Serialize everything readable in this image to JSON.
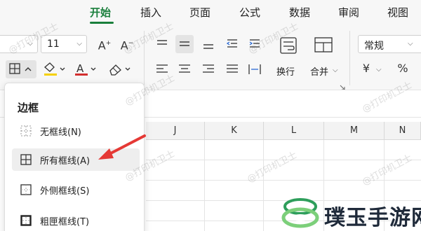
{
  "tabs": [
    {
      "label": "开始",
      "active": true
    },
    {
      "label": "插入",
      "active": false
    },
    {
      "label": "页面",
      "active": false
    },
    {
      "label": "公式",
      "active": false
    },
    {
      "label": "数据",
      "active": false
    },
    {
      "label": "审阅",
      "active": false
    },
    {
      "label": "视图",
      "active": false
    }
  ],
  "ribbon": {
    "font_size": "11",
    "number_format": "常规",
    "wrap_label": "换行",
    "merge_label": "合并",
    "currency_symbol": "¥",
    "percent_symbol": "%",
    "font_color": "#d32f2f",
    "fill_color": "#f5d000"
  },
  "columns": [
    "J",
    "K",
    "L",
    "M",
    "N"
  ],
  "border_menu": {
    "title": "边框",
    "items": [
      {
        "label": "无框线(N)",
        "icon": "no-border-icon"
      },
      {
        "label": "所有框线(A)",
        "icon": "all-borders-icon",
        "highlighted": true
      },
      {
        "label": "外侧框线(S)",
        "icon": "outside-borders-icon"
      },
      {
        "label": "粗匣框线(T)",
        "icon": "thick-box-border-icon"
      }
    ]
  },
  "watermark": "@打印机卫士",
  "brand": {
    "name": "璞玉手游网"
  },
  "accent_color": "#1a7f3c",
  "arrow_color": "#e53935"
}
